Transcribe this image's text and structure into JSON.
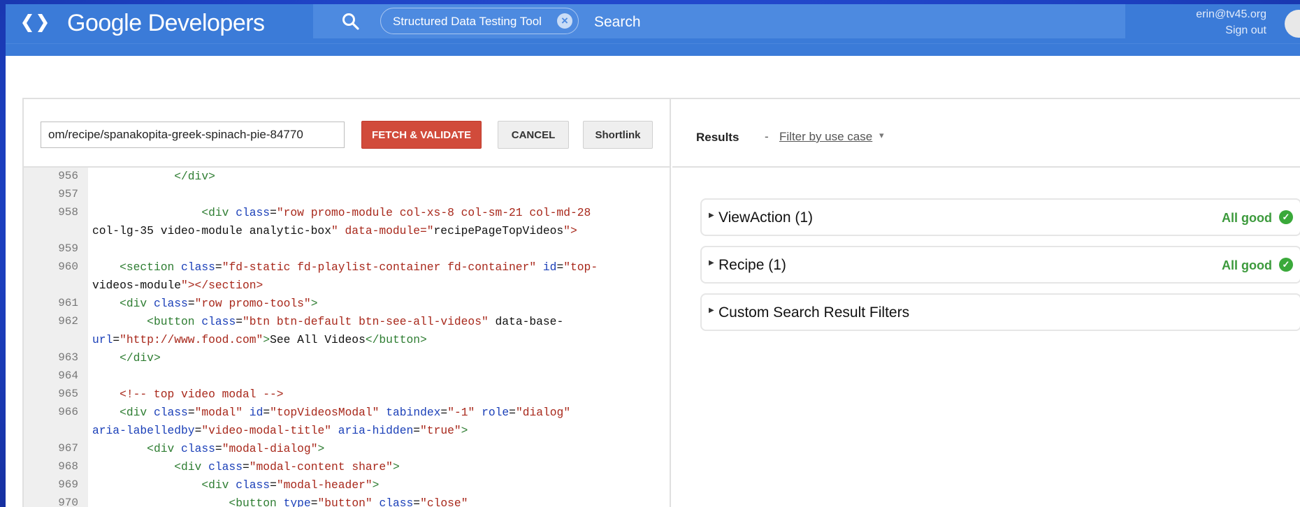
{
  "header": {
    "brand": "Google Developers",
    "search_chip": "Structured Data Testing Tool",
    "search_label": "Search",
    "user_email": "erin@tv45.org",
    "sign_out": "Sign out"
  },
  "toolbar": {
    "url_value": "om/recipe/spanakopita-greek-spinach-pie-84770",
    "fetch_label": "FETCH & VALIDATE",
    "cancel_label": "CANCEL",
    "shortlink_label": "Shortlink"
  },
  "code_lines": [
    {
      "n": "956",
      "t": "            </div>"
    },
    {
      "n": "957",
      "t": ""
    },
    {
      "n": "958",
      "t": "                <div class=\"row promo-module col-xs-8 col-sm-21 col-md-28"
    },
    {
      "n": "",
      "t": "col-lg-35 video-module analytic-box\" data-module=\"recipePageTopVideos\">"
    },
    {
      "n": "959",
      "t": ""
    },
    {
      "n": "960",
      "t": "    <section class=\"fd-static fd-playlist-container fd-container\" id=\"top-"
    },
    {
      "n": "",
      "t": "videos-module\"></section>"
    },
    {
      "n": "961",
      "t": "    <div class=\"row promo-tools\">"
    },
    {
      "n": "962",
      "t": "        <button class=\"btn btn-default btn-see-all-videos\" data-base-"
    },
    {
      "n": "",
      "t": "url=\"http://www.food.com\">See All Videos</button>"
    },
    {
      "n": "963",
      "t": "    </div>"
    },
    {
      "n": "964",
      "t": ""
    },
    {
      "n": "965",
      "t": "    <!-- top video modal -->"
    },
    {
      "n": "966",
      "t": "    <div class=\"modal\" id=\"topVideosModal\" tabindex=\"-1\" role=\"dialog\""
    },
    {
      "n": "",
      "t": "aria-labelledby=\"video-modal-title\" aria-hidden=\"true\">"
    },
    {
      "n": "967",
      "t": "        <div class=\"modal-dialog\">"
    },
    {
      "n": "968",
      "t": "            <div class=\"modal-content share\">"
    },
    {
      "n": "969",
      "t": "                <div class=\"modal-header\">"
    },
    {
      "n": "970",
      "t": "                    <button type=\"button\" class=\"close\""
    }
  ],
  "results": {
    "label": "Results",
    "dash": "-",
    "filter_label": "Filter by use case",
    "cards": [
      {
        "title": "ViewAction (1)",
        "status": "All good"
      },
      {
        "title": "Recipe (1)",
        "status": "All good"
      },
      {
        "title": "Custom Search Result Filters",
        "status": ""
      }
    ]
  },
  "colors": {
    "topbar": "#3b7bd8",
    "fetch_button": "#d14b3b",
    "status_ok": "#3c9a3c",
    "code_tag": "#2e7d32",
    "code_attr": "#1a3fb8",
    "code_string": "#a8281b"
  },
  "icons": {
    "logo": "developers-chevrons-icon",
    "search": "search-icon",
    "clear": "close-icon",
    "status": "check-circle-icon",
    "expand": "caret-right-icon"
  }
}
